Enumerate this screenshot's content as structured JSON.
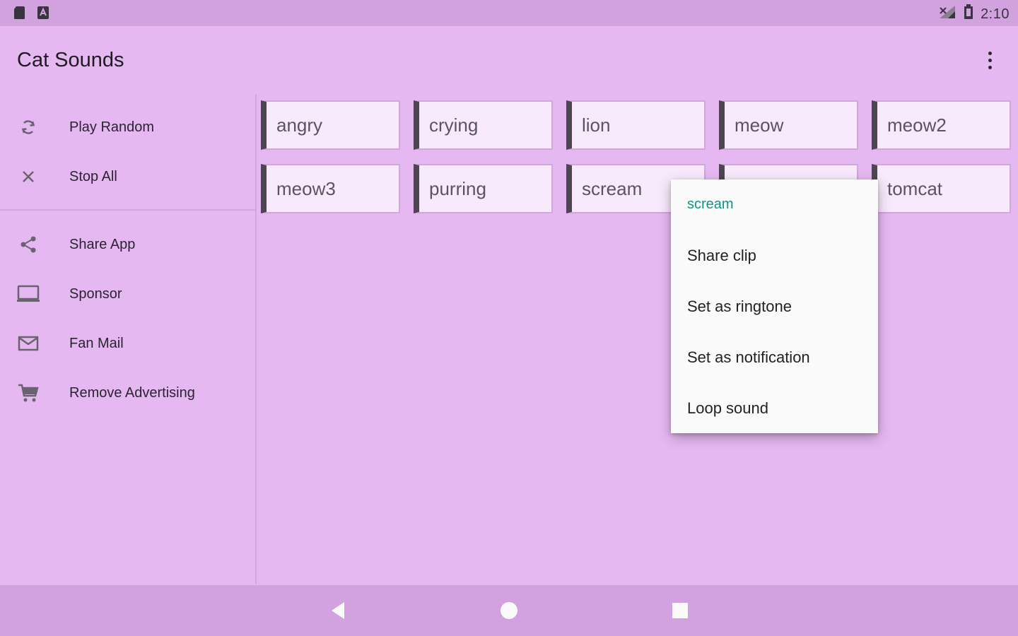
{
  "status_bar": {
    "time": "2:10"
  },
  "app_bar": {
    "title": "Cat Sounds"
  },
  "sidebar": {
    "items": [
      {
        "label": "Play Random",
        "icon": "refresh-icon"
      },
      {
        "label": "Stop All",
        "icon": "close-icon"
      },
      {
        "label": "Share App",
        "icon": "share-icon"
      },
      {
        "label": "Sponsor",
        "icon": "laptop-icon"
      },
      {
        "label": "Fan Mail",
        "icon": "mail-icon"
      },
      {
        "label": "Remove Advertising",
        "icon": "cart-icon"
      }
    ]
  },
  "sounds": [
    "angry",
    "crying",
    "lion",
    "meow",
    "meow2",
    "meow3",
    "purring",
    "scream",
    "",
    "tomcat"
  ],
  "context_menu": {
    "title": "scream",
    "items": [
      "Share clip",
      "Set as ringtone",
      "Set as notification",
      "Loop sound"
    ]
  },
  "colors": {
    "background": "#e6b8f2",
    "status_bar": "#d2a2df",
    "menu_title": "#109484",
    "button_face": "#f8eafc",
    "button_accent": "#4d4650"
  }
}
